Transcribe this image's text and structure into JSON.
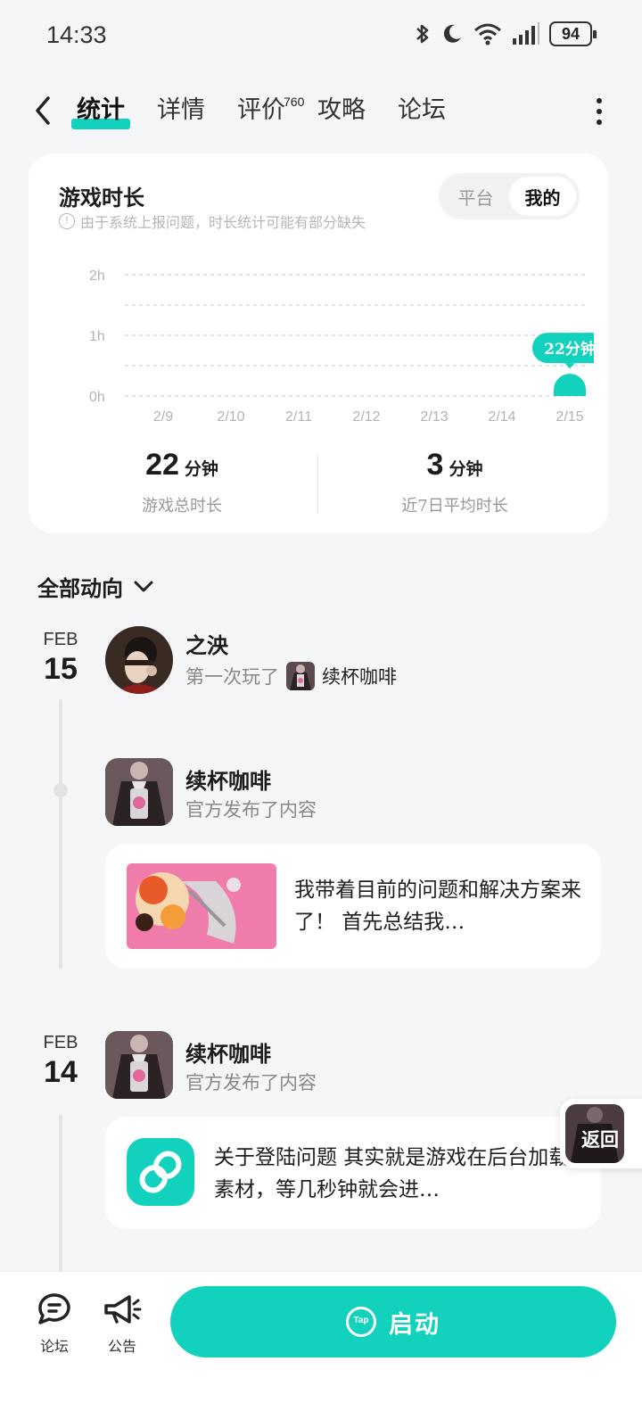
{
  "status_bar": {
    "time": "14:33",
    "battery": "94"
  },
  "nav": {
    "tabs": [
      {
        "label": "统计",
        "active": true
      },
      {
        "label": "详情"
      },
      {
        "label": "评价",
        "badge": "760"
      },
      {
        "label": "攻略"
      },
      {
        "label": "论坛"
      }
    ]
  },
  "stats_card": {
    "title": "游戏时长",
    "note": "由于系统上报问题，时长统计可能有部分缺失",
    "toggle": {
      "platform": "平台",
      "mine": "我的",
      "selected": "我的"
    },
    "summary": [
      {
        "value": "22",
        "unit": "分钟",
        "label": "游戏总时长"
      },
      {
        "value": "3",
        "unit": "分钟",
        "label": "近7日平均时长"
      }
    ]
  },
  "chart_data": {
    "type": "bar",
    "categories": [
      "2/9",
      "2/10",
      "2/11",
      "2/12",
      "2/13",
      "2/14",
      "2/15"
    ],
    "values": [
      0,
      0,
      0,
      0,
      0,
      0,
      22
    ],
    "value_unit": "minutes",
    "y_tick_labels": [
      "2h",
      "1h",
      "0h"
    ],
    "ylim_minutes": [
      0,
      120
    ],
    "highlight_label": "22分钟",
    "accent": "#12d2bd"
  },
  "feed": {
    "filter_label": "全部动向",
    "groups": [
      {
        "month": "FEB",
        "day": "15",
        "entries": [
          {
            "type": "play",
            "user": "之泱",
            "action": "第一次玩了",
            "game": "续杯咖啡"
          },
          {
            "type": "post",
            "author": "续杯咖啡",
            "subtitle": "官方发布了内容",
            "text": "我带着目前的问题和解决方案来了！ 首先总结我…"
          }
        ]
      },
      {
        "month": "FEB",
        "day": "14",
        "entries": [
          {
            "type": "post",
            "author": "续杯咖啡",
            "subtitle": "官方发布了内容",
            "text": "关于登陆问题 其实就是游戏在后台加载素材，等几秒钟就会进…"
          }
        ]
      }
    ]
  },
  "float_return": {
    "label": "返回"
  },
  "bottom_bar": {
    "forum_label": "论坛",
    "notice_label": "公告",
    "launch_label": "启动",
    "launch_logo": "Tap"
  },
  "colors": {
    "accent": "#12d2bd",
    "background": "#f5f6f8"
  }
}
